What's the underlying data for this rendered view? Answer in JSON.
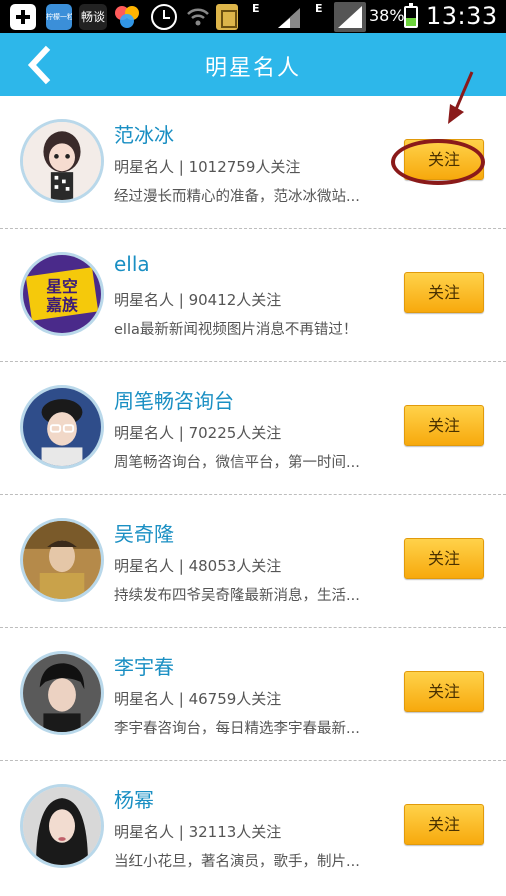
{
  "status_bar": {
    "app1_label": "柠檬一粒",
    "app2_label": "畅谈",
    "network_1": "E",
    "network_2": "E",
    "battery_percent": "38%",
    "time": "13:33"
  },
  "header": {
    "title": "明星名人"
  },
  "list": [
    {
      "name": "范冰冰",
      "meta": "明星名人 | 1012759人关注",
      "desc": "经过漫长而精心的准备，范冰冰微站...",
      "follow": "关注"
    },
    {
      "name": "ella",
      "meta": "明星名人 | 90412人关注",
      "desc": "ella最新新闻视频图片消息不再错过！",
      "follow": "关注"
    },
    {
      "name": "周笔畅咨询台",
      "meta": "明星名人 | 70225人关注",
      "desc": "周笔畅咨询台，微信平台，第一时间...",
      "follow": "关注"
    },
    {
      "name": "吴奇隆",
      "meta": "明星名人 | 48053人关注",
      "desc": "持续发布四爷吴奇隆最新消息，生活...",
      "follow": "关注"
    },
    {
      "name": "李宇春",
      "meta": "明星名人 | 46759人关注",
      "desc": "李宇春咨询台，每日精选李宇春最新...",
      "follow": "关注"
    },
    {
      "name": "杨幂",
      "meta": "明星名人 | 32113人关注",
      "desc": "当红小花旦，著名演员，歌手，制片...",
      "follow": "关注"
    }
  ],
  "avatar_2_text": "星空嘉族",
  "colors": {
    "header_bg": "#2db7ea",
    "name_text": "#1a8fc3",
    "follow_button": "#f7a90d",
    "annotation": "#8a1a1a"
  }
}
